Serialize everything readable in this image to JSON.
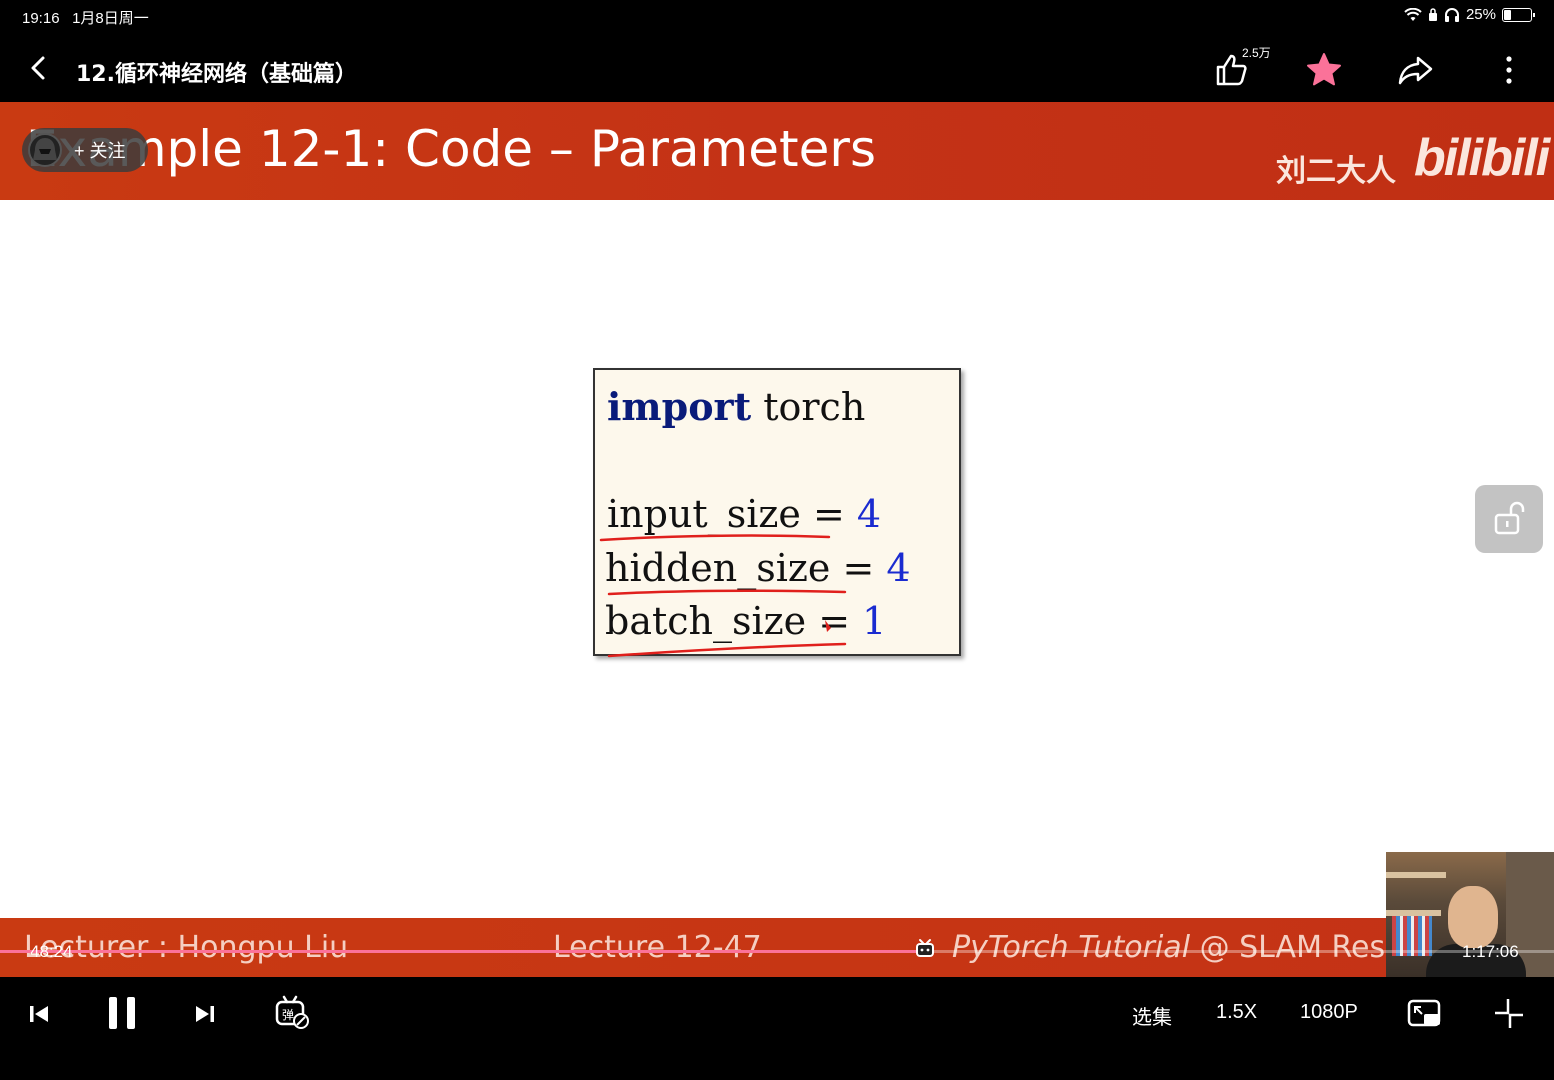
{
  "status_bar": {
    "time": "19:16",
    "date": "1月8日周一",
    "battery": "25%",
    "battery_level": 0.25
  },
  "header": {
    "title": "12.循环神经网络（基础篇）",
    "like_count": "2.5万",
    "favorite_color": "#fb7299"
  },
  "slide": {
    "title": "Example 12-1: Code – Parameters",
    "follow_label": "+ 关注",
    "uploader": "刘二大人",
    "brand": "bilibili",
    "code": {
      "line1_kw": "import",
      "line1_rest": " torch",
      "line2_name": "input_size",
      "line2_eq": " = ",
      "line2_val": "4",
      "line3_name": "hidden_size",
      "line3_eq": " = ",
      "line3_val": "4",
      "line4_name": "batch_size",
      "line4_eq": " = ",
      "line4_val": "1"
    },
    "footer_left": "Lecturer : Hongpu Liu",
    "footer_mid": "Lecture 12-47",
    "footer_right_italic": "PyTorch Tutorial",
    "footer_right_rest": " @ SLAM Resea"
  },
  "player": {
    "current_time": "48:24",
    "total_time": "1:17:06",
    "progress": 0.595,
    "accent": "#fb7299"
  },
  "controls": {
    "episodes": "选集",
    "speed": "1.5X",
    "quality": "1080P"
  }
}
